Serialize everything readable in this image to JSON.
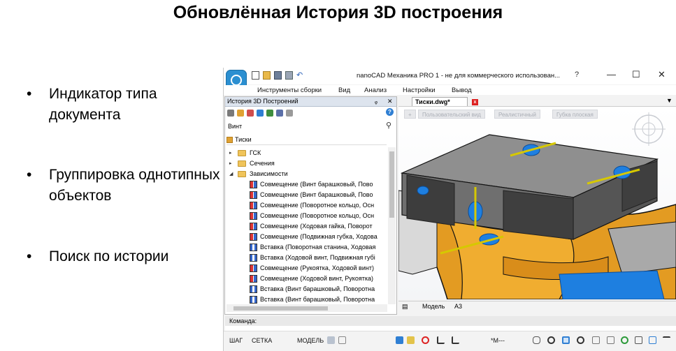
{
  "slide": {
    "title": "Обновлённая История 3D построения",
    "bullets": [
      {
        "dot": "•",
        "text": "Индикатор типа документа"
      },
      {
        "dot": "•",
        "text": "Группировка однотипных объектов"
      },
      {
        "dot": "•",
        "text": "Поиск по истории"
      }
    ]
  },
  "app": {
    "title": "nanoCAD Механика PRO 1 - не для коммерческого использован...",
    "help": "?",
    "window_buttons": {
      "minimize": "—",
      "maximize": "☐",
      "close": "✕"
    },
    "menu": [
      "Инструменты сборки",
      "Вид",
      "Анализ",
      "Настройки",
      "Вывод"
    ],
    "panel": {
      "title": "История 3D Построений",
      "pin": "ᵩ",
      "close": "✕",
      "help": "?",
      "search_value": "Винт",
      "root": "Тиски",
      "tree": [
        {
          "twisty": "▸",
          "kind": "folder",
          "label": "ГСК"
        },
        {
          "twisty": "▸",
          "kind": "folder",
          "label": "Сечения"
        },
        {
          "twisty": "◢",
          "kind": "folder",
          "label": "Зависимости"
        },
        {
          "kind": "sov",
          "label": "Совмещение (Винт барашковый, Пово"
        },
        {
          "kind": "sov",
          "label": "Совмещение (Винт барашковый, Пово"
        },
        {
          "kind": "sov",
          "label": "Совмещение (Поворотное кольцо, Осн"
        },
        {
          "kind": "sov",
          "label": "Совмещение (Поворотное кольцо, Осн"
        },
        {
          "kind": "sov",
          "label": "Совмещение (Ходовая гайка, Поворот"
        },
        {
          "kind": "sov",
          "label": "Совмещение (Подвижная губка, Ходова"
        },
        {
          "kind": "vst",
          "label": "Вставка (Поворотная станина, Ходовая"
        },
        {
          "kind": "vst",
          "label": "Вставка (Ходовой винт, Подвижная губі"
        },
        {
          "kind": "sov",
          "label": "Совмещение (Рукоятка, Ходовой винт)"
        },
        {
          "kind": "sov",
          "label": "Совмещение (Ходовой винт, Рукоятка)"
        },
        {
          "kind": "vst",
          "label": "Вставка (Винт барашковый, Поворотна"
        },
        {
          "kind": "vst",
          "label": "Вставка (Винт барашковый, Поворотна"
        }
      ]
    },
    "doc_tab": "Тиски.dwg*",
    "doc_tab_menu": "▼",
    "viewport_chips": [
      "+",
      "Пользовательский вид",
      "Реалистичный",
      "Губка плоская"
    ],
    "layout_tabs": [
      "Модель",
      "A3"
    ],
    "command_label": "Команда:",
    "status": {
      "snap": "ШАГ",
      "grid": "СЕТКА",
      "model": "МОДЕЛЬ",
      "scale": "*M---"
    }
  }
}
